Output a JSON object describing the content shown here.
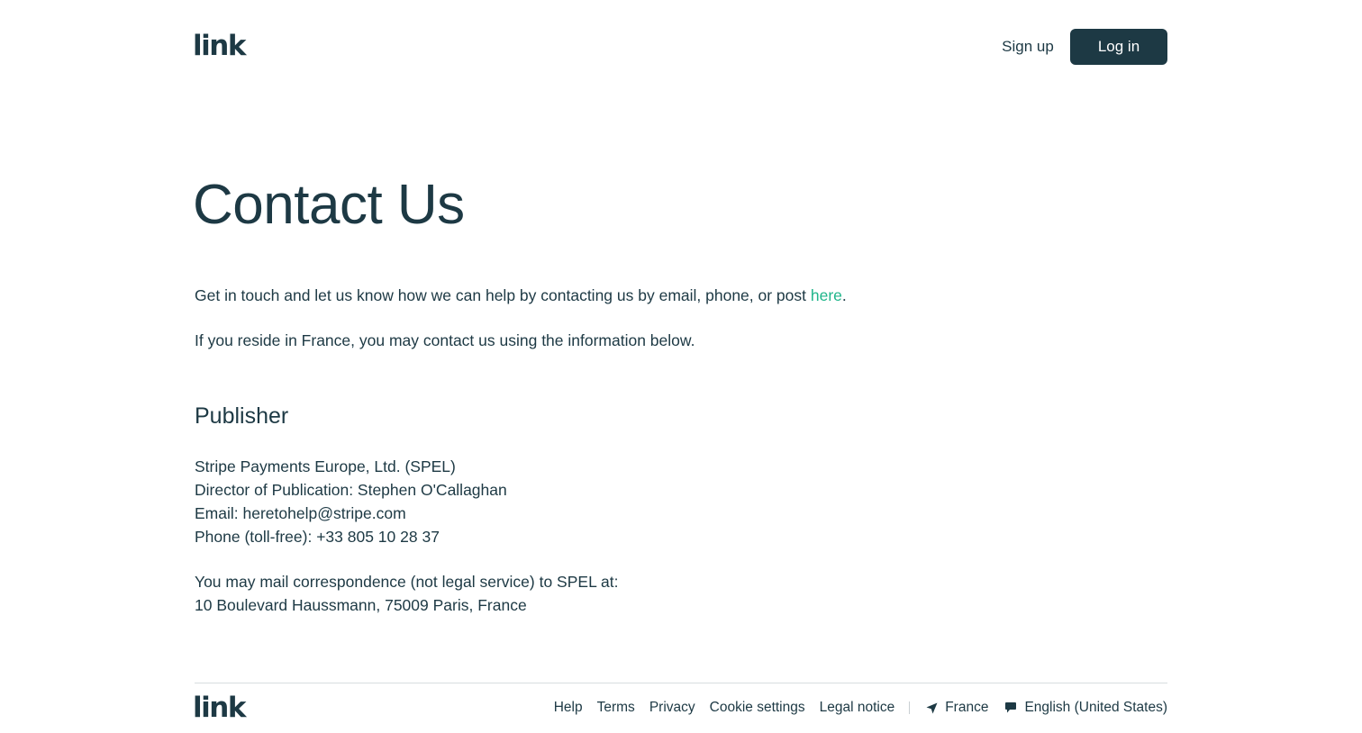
{
  "header": {
    "logo": "link",
    "signup_label": "Sign up",
    "login_label": "Log in"
  },
  "main": {
    "title": "Contact Us",
    "intro_text": "Get in touch and let us know how we can help by contacting us by email, phone, or post ",
    "intro_link": "here",
    "intro_end": ".",
    "france_text": "If you reside in France, you may contact us using the information below.",
    "publisher_heading": "Publisher",
    "publisher_lines": [
      "Stripe Payments Europe, Ltd. (SPEL)",
      "Director of Publication: Stephen O'Callaghan",
      "Email: heretohelp@stripe.com",
      "Phone (toll-free): +33 805 10 28 37"
    ],
    "mail_lines": [
      "You may mail correspondence (not legal service) to SPEL at:",
      "10 Boulevard Haussmann, 75009 Paris, France"
    ]
  },
  "footer": {
    "logo": "link",
    "links": [
      "Help",
      "Terms",
      "Privacy",
      "Cookie settings",
      "Legal notice"
    ],
    "country": "France",
    "language": "English (United States)"
  },
  "colors": {
    "primary": "#1d3944",
    "accent": "#1fb58a"
  },
  "icons": {
    "country": "location-arrow-icon",
    "language": "speech-bubble-icon"
  }
}
